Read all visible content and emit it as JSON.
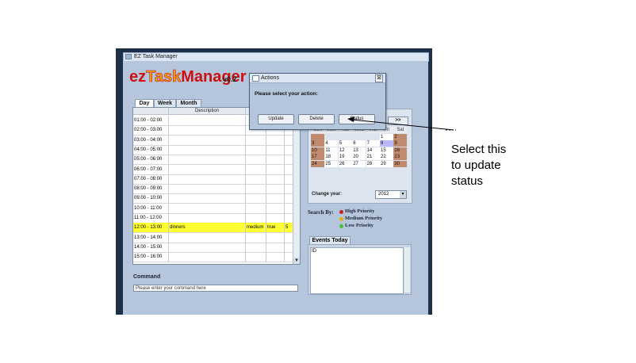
{
  "window": {
    "title": "EZ Task Manager"
  },
  "logo": {
    "ez": "ez",
    "task": "Task",
    "manager": "Manager",
    "version": "v0.2"
  },
  "tabs": [
    {
      "label": "Day"
    },
    {
      "label": "Week"
    },
    {
      "label": "Month"
    }
  ],
  "schedule": {
    "header": {
      "description": "Description"
    },
    "rows": [
      {
        "time": "01:00 - 02:00",
        "desc": "",
        "priority": "",
        "done": "",
        "id": ""
      },
      {
        "time": "02:00 - 03:00",
        "desc": "",
        "priority": "",
        "done": "",
        "id": ""
      },
      {
        "time": "03:00 - 04:00",
        "desc": "",
        "priority": "",
        "done": "",
        "id": ""
      },
      {
        "time": "04:00 - 05:00",
        "desc": "",
        "priority": "",
        "done": "",
        "id": ""
      },
      {
        "time": "05:00 - 06:00",
        "desc": "",
        "priority": "",
        "done": "",
        "id": ""
      },
      {
        "time": "06:00 - 07:00",
        "desc": "",
        "priority": "",
        "done": "",
        "id": ""
      },
      {
        "time": "07:00 - 08:00",
        "desc": "",
        "priority": "",
        "done": "",
        "id": ""
      },
      {
        "time": "08:00 - 09:00",
        "desc": "",
        "priority": "",
        "done": "",
        "id": ""
      },
      {
        "time": "09:00 - 10:00",
        "desc": "",
        "priority": "",
        "done": "",
        "id": ""
      },
      {
        "time": "10:00 - 11:00",
        "desc": "",
        "priority": "",
        "done": "",
        "id": ""
      },
      {
        "time": "11:00 - 12:00",
        "desc": "",
        "priority": "",
        "done": "",
        "id": ""
      },
      {
        "time": "12:00 - 13:00",
        "desc": "dinners",
        "priority": "medium",
        "done": "true",
        "id": "5"
      },
      {
        "time": "13:00 - 14:00",
        "desc": "",
        "priority": "",
        "done": "",
        "id": ""
      },
      {
        "time": "14:00 - 15:00",
        "desc": "",
        "priority": "",
        "done": "",
        "id": ""
      },
      {
        "time": "15:00 - 16:00",
        "desc": "",
        "priority": "",
        "done": "",
        "id": ""
      }
    ]
  },
  "command": {
    "label": "Command",
    "placeholder": "Please enter your command here"
  },
  "calendar": {
    "next_label": ">>",
    "weekdays": [
      "Sun",
      "Mon",
      "Tue",
      "Wed",
      "Thu",
      "Fri",
      "Sat"
    ],
    "days": [
      [
        "",
        "",
        "",
        "",
        "",
        "1",
        "2"
      ],
      [
        "3",
        "4",
        "5",
        "6",
        "7",
        "8",
        "9"
      ],
      [
        "10",
        "11",
        "12",
        "13",
        "14",
        "15",
        "16"
      ],
      [
        "17",
        "18",
        "19",
        "20",
        "21",
        "22",
        "23"
      ],
      [
        "24",
        "25",
        "26",
        "27",
        "28",
        "29",
        "30"
      ]
    ],
    "change_year_label": "Change year:",
    "year": "2012"
  },
  "search": {
    "label": "Search By:",
    "high": "High Priority",
    "medium": "Medium Priority",
    "low": "Low Priority",
    "colors": {
      "high": "#d42020",
      "medium": "#e0b010",
      "low": "#4bbf3a"
    }
  },
  "events": {
    "tab_label": "Events Today",
    "column": "ID"
  },
  "dialog": {
    "title": "Actions",
    "message": "Please select your action:",
    "update": "Update",
    "delete": "Delete",
    "status": "Status"
  },
  "annotation": {
    "text_line1": "Select this",
    "text_line2": "to update",
    "text_line3": "status"
  }
}
